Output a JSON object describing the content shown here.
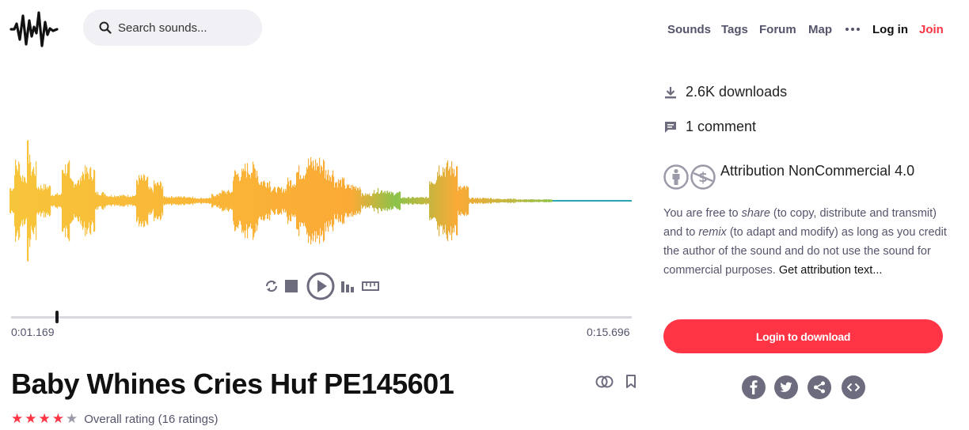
{
  "header": {
    "search_placeholder": "Search sounds...",
    "nav": {
      "sounds": "Sounds",
      "tags": "Tags",
      "forum": "Forum",
      "map": "Map",
      "login": "Log in",
      "join": "Join"
    }
  },
  "player": {
    "current_time": "0:01.169",
    "total_time": "0:15.696",
    "played_fraction": 0.074,
    "wave_color_start": "#f7c53a",
    "wave_color_mid": "#fbaa36",
    "wave_color_end": "#8bc34a",
    "baseline_color": "#2ba6b5"
  },
  "sound": {
    "title": "Baby Whines Cries Huf PE145601",
    "rating_stars": 4,
    "rating_max": 5,
    "rating_text": "Overall rating (16 ratings)"
  },
  "sidebar": {
    "downloads": "2.6K downloads",
    "comments": "1 comment",
    "license_title": "Attribution NonCommercial 4.0",
    "license_text": {
      "part1": "You are free to ",
      "share": "share",
      "part2": " (to copy, distribute and transmit) and to ",
      "remix": "remix",
      "part3": " (to adapt and modify) as long as you credit the author of the sound and do not use the sound for commercial purposes. ",
      "link": "Get attribution text..."
    },
    "download_button": "Login to download"
  },
  "colors": {
    "accent": "#ff3546",
    "text_muted": "#54546b",
    "icon_gray": "#6c6c7e",
    "star_on": "#ff3546",
    "star_off": "#9a9aa8"
  }
}
